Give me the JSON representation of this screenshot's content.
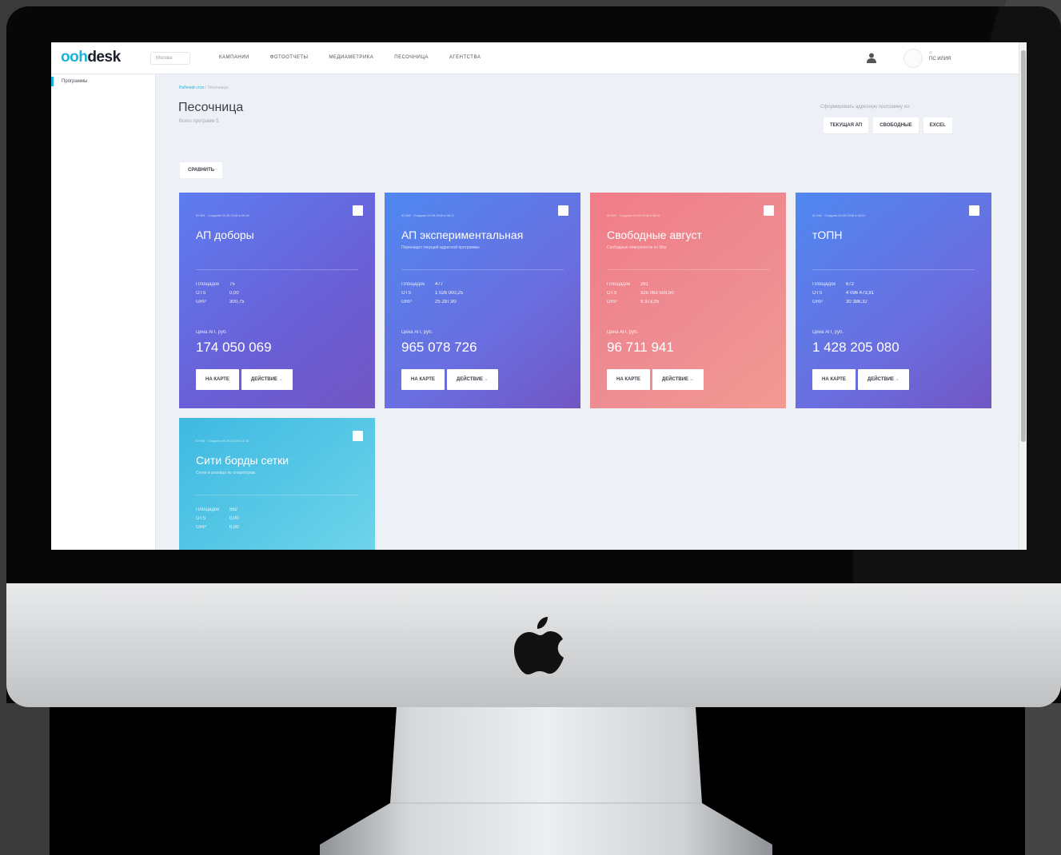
{
  "app": {
    "logo_prefix": "ooh",
    "logo_suffix": "desk",
    "city": "Москва",
    "nav": [
      "КАМПАНИИ",
      "ФОТООТЧЕТЫ",
      "МЕДИАМЕТРИКА",
      "ПЕСОЧНИЦА",
      "АГЕНТСТВА"
    ],
    "user_small": "ID",
    "user_name": "ПС ИЛИЯ"
  },
  "sidebar": {
    "items": [
      {
        "label": "Программы"
      }
    ]
  },
  "breadcrumb": {
    "root": "Рабочий стол",
    "sep": "/",
    "current": "Песочница"
  },
  "page": {
    "title": "Песочница",
    "subtitle": "Всего программ 5",
    "generate_label": "Сформировать адресную программу из:",
    "buttons": [
      "ТЕКУЩАЯ АП",
      "СВОБОДНЫЕ",
      "EXCEL"
    ],
    "compare_button": "СРАВНИТЬ"
  },
  "card_labels": {
    "area": "Площадок",
    "ots": "OTS",
    "grp": "GRP",
    "price": "Цена АП, руб.",
    "on_map": "НА КАРТЕ",
    "action": "ДЕЙСТВИЕ",
    "action_chevron": "⌄"
  },
  "cards": [
    {
      "meta": "ID 561 · Создана 03.09.2018 в 09:18",
      "title": "АП доборы",
      "desc": "",
      "area": "75",
      "ots": "0,00",
      "grp": "300,75",
      "price": "174 050 069"
    },
    {
      "meta": "ID 558 · Создана 03.09.2018 в 08:17",
      "title": "АП экспериментальная",
      "desc": "Перенацел текущей адресной программы",
      "area": "477",
      "ots": "1 026 000,25",
      "grp": "25 297,90",
      "price": "965 078 726"
    },
    {
      "meta": "ID 549 · Создана 03.09.2018 в 05:16",
      "title": "Свободные август",
      "desc": "Свободные поверхности по Мск",
      "area": "261",
      "ots": "325 063 503,50",
      "grp": "9 373,05",
      "price": "96 711 941"
    },
    {
      "meta": "ID 544 · Создана 03.09.2018 в 03:22",
      "title": "тОПН",
      "desc": "",
      "area": "672",
      "ots": "4 096 473,91",
      "grp": "30 386,32",
      "price": "1 428 205 080"
    },
    {
      "meta": "ID 541 · Создана 06.09.2018 в 11:18",
      "title": "Сити борды сетки",
      "desc": "Сетки и розница по операторам",
      "area": "552",
      "ots": "0,00",
      "grp": "0,00",
      "price": ""
    }
  ]
}
